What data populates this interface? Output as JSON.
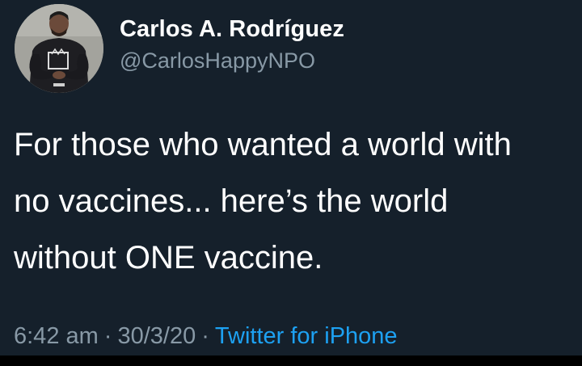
{
  "user": {
    "display_name": "Carlos A. Rodríguez",
    "handle": "@CarlosHappyNPO"
  },
  "tweet": {
    "lines": [
      "For those who wanted a world with",
      "no vaccines... here’s the world",
      "without ONE vaccine."
    ],
    "time": "6:42 am",
    "date": "30/3/20",
    "separator": "·",
    "source": "Twitter for iPhone"
  },
  "colors": {
    "background": "#15202b",
    "text": "#ffffff",
    "secondary_text": "#8899a6",
    "link": "#1da1f2"
  }
}
